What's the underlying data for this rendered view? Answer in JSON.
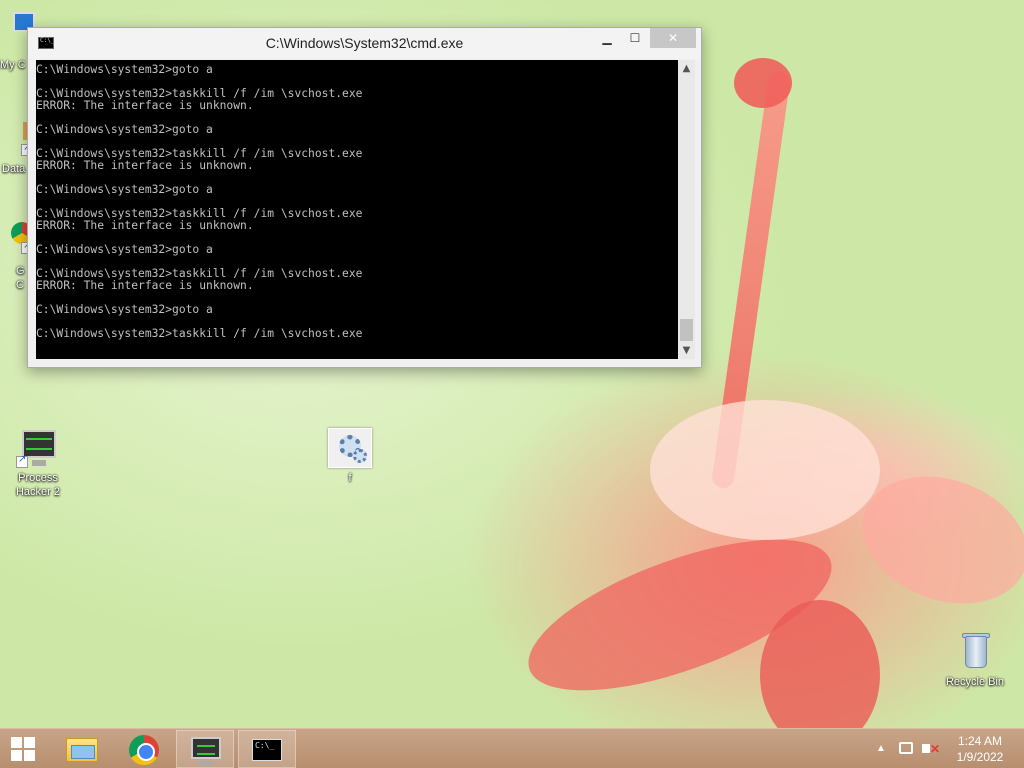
{
  "desktop": {
    "icons": [
      {
        "label": "My C",
        "icon": "computer-icon"
      },
      {
        "label": "Data",
        "icon": "shortcut-icon"
      },
      {
        "label": "G\nC",
        "icon": "chrome-icon"
      },
      {
        "label": "Process Hacker 2",
        "icon": "process-hacker-icon"
      },
      {
        "label": "f",
        "icon": "gear-batch-icon"
      },
      {
        "label": "Recycle Bin",
        "icon": "recycle-bin-icon"
      }
    ]
  },
  "cmd_window": {
    "title": "C:\\Windows\\System32\\cmd.exe",
    "controls": {
      "minimize": "▁",
      "maximize": "☐",
      "close": "✕"
    },
    "lines": [
      "C:\\Windows\\system32>goto a",
      "",
      "C:\\Windows\\system32>taskkill /f /im \\svchost.exe",
      "ERROR: The interface is unknown.",
      "",
      "C:\\Windows\\system32>goto a",
      "",
      "C:\\Windows\\system32>taskkill /f /im \\svchost.exe",
      "ERROR: The interface is unknown.",
      "",
      "C:\\Windows\\system32>goto a",
      "",
      "C:\\Windows\\system32>taskkill /f /im \\svchost.exe",
      "ERROR: The interface is unknown.",
      "",
      "C:\\Windows\\system32>goto a",
      "",
      "C:\\Windows\\system32>taskkill /f /im \\svchost.exe",
      "ERROR: The interface is unknown.",
      "",
      "C:\\Windows\\system32>goto a",
      "",
      "C:\\Windows\\system32>taskkill /f /im \\svchost.exe"
    ]
  },
  "taskbar": {
    "pinned": [
      {
        "name": "file-explorer",
        "icon": "folder-icon"
      },
      {
        "name": "chrome",
        "icon": "chrome-icon"
      },
      {
        "name": "process-hacker",
        "icon": "process-hacker-icon"
      },
      {
        "name": "command-prompt",
        "icon": "cmd-icon",
        "active": true
      }
    ],
    "cmd_glyph": "C:\\_",
    "tray": {
      "chevron": "▲",
      "volume_mute": "✕",
      "time": "1:24 AM",
      "date": "1/9/2022"
    }
  },
  "colors": {
    "console_bg": "#000000",
    "console_text": "#c0c0c0",
    "taskbar": "#b78f6f"
  }
}
